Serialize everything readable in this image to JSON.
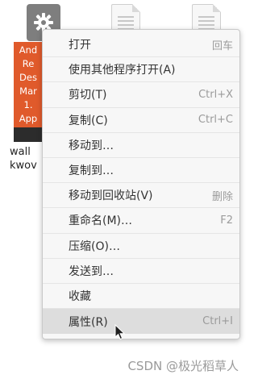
{
  "desktop": {
    "icons": [
      {
        "name": "gear-file",
        "type": "executable"
      },
      {
        "name": "document-file-1",
        "type": "text"
      },
      {
        "name": "document-file-2",
        "type": "text"
      }
    ],
    "book_cover_lines": [
      "And",
      "Re",
      "Des",
      "Mar",
      "1.",
      "App"
    ],
    "selected_file_label_lines": [
      "wall",
      "kwov"
    ]
  },
  "context_menu": {
    "items": [
      {
        "label": "打开",
        "shortcut": "回车"
      },
      {
        "label": "使用其他程序打开(A)",
        "shortcut": ""
      },
      {
        "label": "剪切(T)",
        "shortcut": "Ctrl+X"
      },
      {
        "label": "复制(C)",
        "shortcut": "Ctrl+C"
      },
      {
        "label": "移动到…",
        "shortcut": ""
      },
      {
        "label": "复制到…",
        "shortcut": ""
      },
      {
        "label": "移动到回收站(V)",
        "shortcut": "删除"
      },
      {
        "label": "重命名(M)…",
        "shortcut": "F2"
      },
      {
        "label": "压缩(O)…",
        "shortcut": ""
      },
      {
        "label": "发送到…",
        "shortcut": ""
      },
      {
        "label": "收藏",
        "shortcut": ""
      },
      {
        "label": "属性(R)",
        "shortcut": "Ctrl+I"
      }
    ],
    "highlighted_index": 11
  },
  "watermark": "CSDN @极光稻草人",
  "colors": {
    "book_cover": "#e05a2b",
    "menu_background": "#f7f7f7",
    "highlight": "#dddddd",
    "shortcut_text": "#9b9b9b"
  }
}
